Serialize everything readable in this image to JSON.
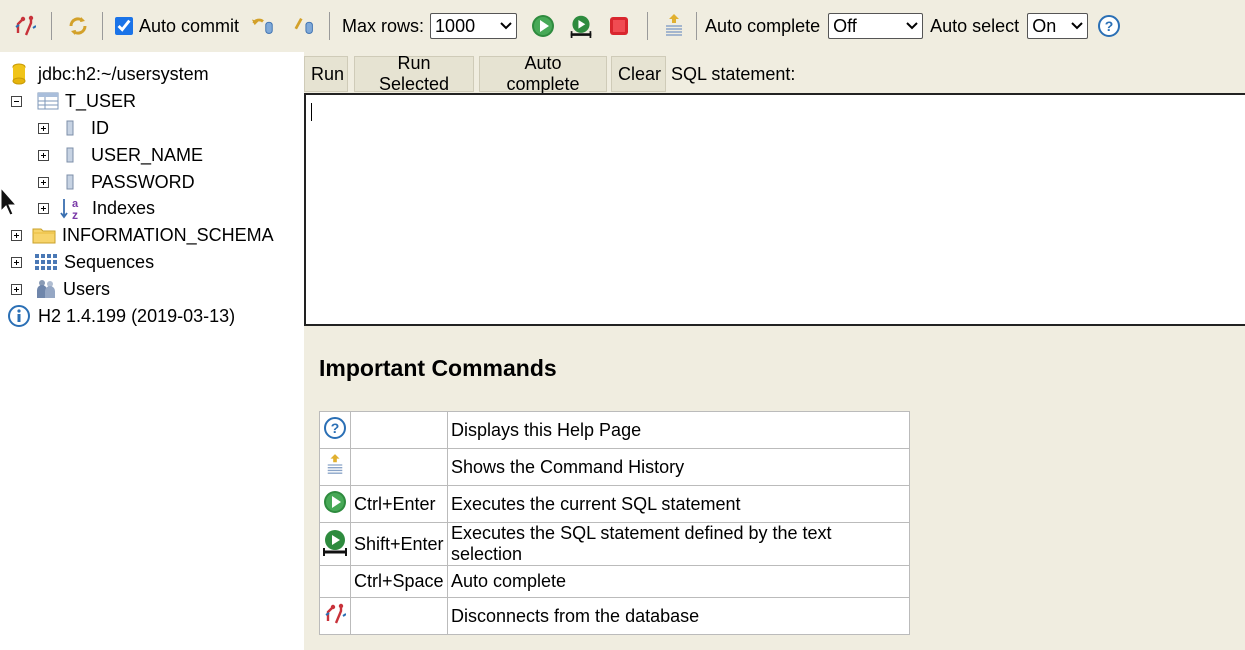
{
  "toolbar": {
    "auto_commit_label": "Auto commit",
    "auto_commit_checked": true,
    "max_rows_label": "Max rows:",
    "max_rows_value": "1000",
    "auto_complete_label": "Auto complete",
    "auto_complete_value": "Off",
    "auto_select_label": "Auto select",
    "auto_select_value": "On",
    "icons": [
      "disconnect-icon",
      "refresh-icon",
      "rollback-icon",
      "commit-icon",
      "run-icon",
      "run-selected-icon",
      "stop-icon",
      "history-icon",
      "help-icon"
    ]
  },
  "tree": {
    "connection": "jdbc:h2:~/usersystem",
    "table": "T_USER",
    "columns": [
      "ID",
      "USER_NAME",
      "PASSWORD"
    ],
    "indexes": "Indexes",
    "schema": "INFORMATION_SCHEMA",
    "sequences": "Sequences",
    "users": "Users",
    "version": "H2 1.4.199 (2019-03-13)"
  },
  "editor": {
    "run": "Run",
    "run_selected": "Run Selected",
    "auto_complete": "Auto complete",
    "clear": "Clear",
    "sql_label": "SQL statement:"
  },
  "commands": {
    "title": "Important Commands",
    "rows": [
      {
        "icon": "help-icon",
        "key": "",
        "desc": "Displays this Help Page"
      },
      {
        "icon": "history-icon",
        "key": "",
        "desc": "Shows the Command History"
      },
      {
        "icon": "run-icon",
        "key": "Ctrl+Enter",
        "desc": "Executes the current SQL statement"
      },
      {
        "icon": "run-selected-icon",
        "key": "Shift+Enter",
        "desc": "Executes the SQL statement defined by the text selection"
      },
      {
        "icon": "",
        "key": "Ctrl+Space",
        "desc": "Auto complete"
      },
      {
        "icon": "disconnect-icon",
        "key": "",
        "desc": "Disconnects from the database"
      }
    ]
  },
  "colors": {
    "panel_bg": "#f0ede0",
    "button_bg": "#e6e3d2",
    "run_green": "#2e8b3e",
    "stop_red": "#d9262e",
    "help_blue": "#2a6fb5"
  }
}
